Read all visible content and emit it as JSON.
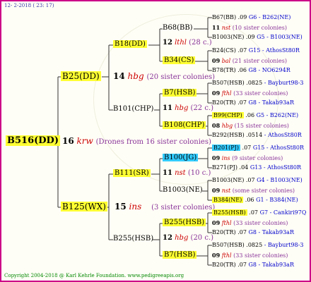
{
  "header": {
    "date": "12-  2-2018 ( 23: 17)"
  },
  "footer": {
    "text": "Copyright 2004-2018 @ Karl Kehrle Foundation.   www.pedigreeapis.org"
  },
  "root": {
    "name": "B516(DD)",
    "num": "16",
    "code": "krw",
    "note": "(Drones from 16 sister colonies)"
  },
  "gen2": [
    {
      "name": "B25(DD)",
      "num": "14",
      "code": "hbg",
      "note": "(20 sister colonies)"
    },
    {
      "name": "B125(WX)",
      "num": "15",
      "code": "ins",
      "note": "(3 sister colonies)"
    }
  ],
  "gen3": [
    {
      "name": "B18(DD)",
      "num": "12",
      "code": "lthl",
      "note": "(28 c.)"
    },
    {
      "name": "B101(CHP)",
      "num": "11",
      "code": "hbg",
      "note": "(22 c.)"
    },
    {
      "name": "B111(SR)",
      "num": "11",
      "code": "nst",
      "note": "(10 c.)"
    },
    {
      "name": "B255(HSB)",
      "num": "12",
      "code": "hbg",
      "note": "(20 c.)"
    }
  ],
  "gen4": [
    {
      "name": "B68(BB)",
      "num": "11",
      "code": "nst",
      "note": "(10 sister colonies)"
    },
    {
      "name": "B34(CS)",
      "num": "09",
      "code": "bal",
      "note": "(21 sister colonies)"
    },
    {
      "name": "B7(HSB)",
      "num": "09",
      "code": "fthl",
      "note": "(33 sister colonies)"
    },
    {
      "name": "B108(CHP)",
      "num": "08",
      "code": "hbg",
      "note": "(15 sister colonies)"
    },
    {
      "name": "B100(JG)",
      "num": "09",
      "code": "ins",
      "note": "(9 sister colonies)"
    },
    {
      "name": "B1003(NE)",
      "num": "09",
      "code": "nst",
      "note": "(some sister colonies)"
    },
    {
      "name": "B255(HSB)",
      "num": "09",
      "code": "fthl",
      "note": "(33 sister colonies)"
    },
    {
      "name": "B7(HSB)",
      "num": "09",
      "code": "fthl",
      "note": "(33 sister colonies)"
    }
  ],
  "gen5": [
    {
      "name": "B67(BB)",
      "yr": ".09",
      "breeder": "G6 - B262(NE)"
    },
    {
      "name": "B1003(NE)",
      "yr": ".09",
      "breeder": "G5 - B1003(NE)"
    },
    {
      "name": "B24(CS)",
      "yr": ".07",
      "breeder": "G15 - AthosSt80R"
    },
    {
      "name": "B78(TR)",
      "yr": ".06",
      "breeder": "G8 - NO6294R"
    },
    {
      "name": "B507(HSB)",
      "yr": ".0825",
      "breeder": "- Bayburt98-3"
    },
    {
      "name": "B20(TR)",
      "yr": ".07",
      "breeder": "G8 - Takab93aR"
    },
    {
      "name": "B99(CHP)",
      "yr": ".06",
      "breeder": "G5 - B262(NE)"
    },
    {
      "name": "B292(HSB)",
      "yr": ".0514",
      "breeder": "- AthosSt80R"
    },
    {
      "name": "B201(PJ)",
      "yr": ".07",
      "breeder": "G15 - AthosSt80R"
    },
    {
      "name": "B271(PJ)",
      "yr": ".04",
      "breeder": "G13 - AthosSt80R"
    },
    {
      "name": "B1003(NE)",
      "yr": ".07",
      "breeder": "G4 - B1003(NE)"
    },
    {
      "name": "B384(NE)",
      "yr": ".06",
      "breeder": "G1 - B384(NE)"
    },
    {
      "name": "B255(HSB)",
      "yr": ".07",
      "breeder": "G7 - Cankiri97Q"
    },
    {
      "name": "B20(TR)",
      "yr": ".07",
      "breeder": "G8 - Takab93aR"
    },
    {
      "name": "B507(HSB)",
      "yr": ".0825",
      "breeder": "- Bayburt98-3"
    },
    {
      "name": "B20(TR)",
      "yr": ".07",
      "breeder": "G8 - Takab93aR"
    }
  ]
}
